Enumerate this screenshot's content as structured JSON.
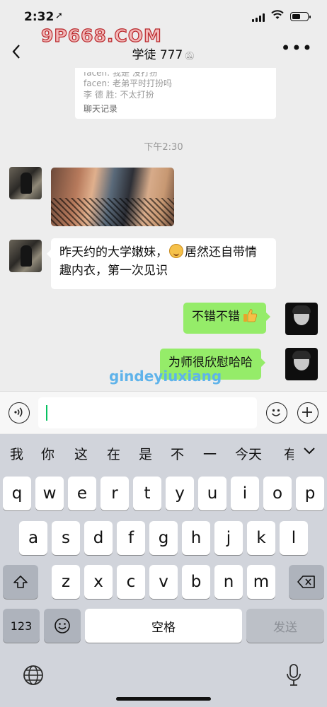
{
  "status_bar": {
    "time": "2:32",
    "location_icon": "location-arrow-icon"
  },
  "watermarks": {
    "top": "9P668.COM",
    "bottom": "gindeyiuxiang"
  },
  "nav": {
    "title": "学徒 777",
    "back_icon": "chevron-left-icon",
    "more_icon": "ellipsis-icon",
    "mute_icon": "bell-muted-icon"
  },
  "chat_record": {
    "lines": [
      "facen: 我是 没打扮",
      "facen: 老弟平时打扮吗",
      "李 德 胜: 不太打扮"
    ],
    "footer": "聊天记录"
  },
  "timestamp": "下午2:30",
  "messages": [
    {
      "side": "in",
      "type": "image"
    },
    {
      "side": "in",
      "type": "text",
      "text_before": "昨天约的大学嫩妹，",
      "emoji": "smile-emoji",
      "text_after": "居然还自带情趣内衣，第一次见识"
    },
    {
      "side": "out",
      "type": "text",
      "text": "不错不错",
      "emoji": "thumbs-up-emoji"
    },
    {
      "side": "out",
      "type": "text",
      "text": "为师很欣慰哈哈"
    }
  ],
  "input": {
    "value": ""
  },
  "keyboard": {
    "candidates": [
      "我",
      "你",
      "这",
      "在",
      "是",
      "不",
      "一",
      "今天",
      "有"
    ],
    "row1": [
      "q",
      "w",
      "e",
      "r",
      "t",
      "y",
      "u",
      "i",
      "o",
      "p"
    ],
    "row2": [
      "a",
      "s",
      "d",
      "f",
      "g",
      "h",
      "j",
      "k",
      "l"
    ],
    "row3": [
      "z",
      "x",
      "c",
      "v",
      "b",
      "n",
      "m"
    ],
    "num_label": "123",
    "space_label": "空格",
    "send_label": "发送"
  },
  "colors": {
    "outgoing_bubble": "#95ec69",
    "incoming_bubble": "#ffffff",
    "accent": "#07c160"
  }
}
